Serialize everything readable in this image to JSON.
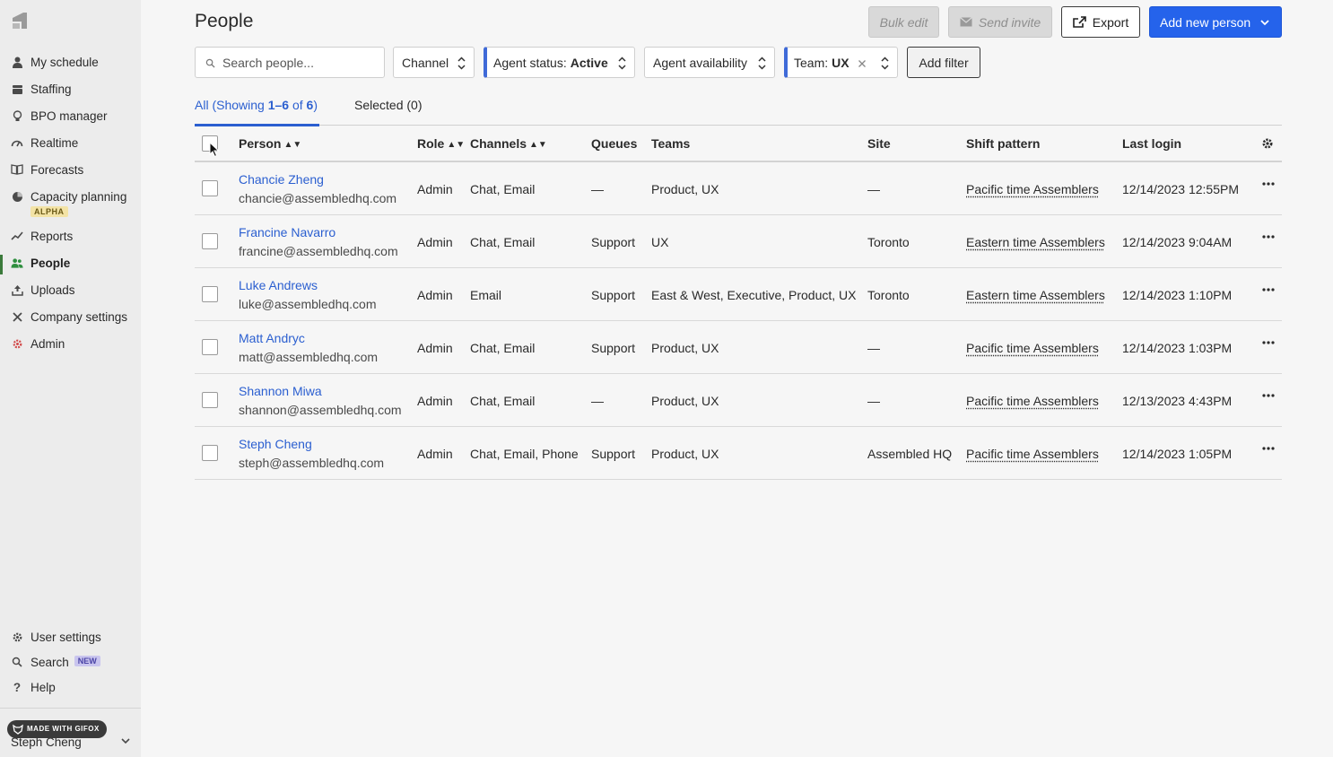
{
  "sidebar": {
    "items": [
      {
        "label": "My schedule",
        "icon": "person-icon"
      },
      {
        "label": "Staffing",
        "icon": "staffing-icon"
      },
      {
        "label": "BPO manager",
        "icon": "lightbulb-icon"
      },
      {
        "label": "Realtime",
        "icon": "gauge-icon"
      },
      {
        "label": "Forecasts",
        "icon": "book-icon"
      },
      {
        "label": "Capacity planning",
        "icon": "pie-icon",
        "badge": "ALPHA"
      },
      {
        "label": "Reports",
        "icon": "trend-icon"
      },
      {
        "label": "People",
        "icon": "people-icon",
        "active": true
      },
      {
        "label": "Uploads",
        "icon": "upload-icon"
      },
      {
        "label": "Company settings",
        "icon": "tools-icon"
      },
      {
        "label": "Admin",
        "icon": "admin-gear-icon"
      }
    ],
    "bottom": [
      {
        "label": "User settings",
        "icon": "gear-icon"
      },
      {
        "label": "Search",
        "icon": "search-icon",
        "badge": "NEW"
      },
      {
        "label": "Help",
        "icon": "help-icon"
      }
    ],
    "user_name": "Steph Cheng",
    "gifox_label": "MADE WITH GIFOX"
  },
  "header": {
    "title": "People",
    "bulk_edit": "Bulk edit",
    "send_invite": "Send invite",
    "export": "Export",
    "add_new_person": "Add new person"
  },
  "filters": {
    "search_placeholder": "Search people...",
    "channel": "Channel",
    "agent_status_label": "Agent status:",
    "agent_status_value": "Active",
    "agent_availability": "Agent availability",
    "team_label": "Team:",
    "team_value": "UX",
    "add_filter": "Add filter"
  },
  "tabs": {
    "all_prefix": "All (Showing ",
    "all_range": "1–6",
    "all_mid": " of ",
    "all_total": "6",
    "all_suffix": ")",
    "selected": "Selected (0)"
  },
  "table": {
    "columns": {
      "person": "Person",
      "role": "Role",
      "channels": "Channels",
      "queues": "Queues",
      "teams": "Teams",
      "site": "Site",
      "shift": "Shift pattern",
      "last_login": "Last login"
    },
    "rows": [
      {
        "name": "Chancie Zheng",
        "email": "chancie@assembledhq.com",
        "role": "Admin",
        "channels": "Chat, Email",
        "queues": "—",
        "teams": "Product, UX",
        "site": "—",
        "shift": "Pacific time Assemblers",
        "last_login": "12/14/2023 12:55PM"
      },
      {
        "name": "Francine Navarro",
        "email": "francine@assembledhq.com",
        "role": "Admin",
        "channels": "Chat, Email",
        "queues": "Support",
        "teams": "UX",
        "site": "Toronto",
        "shift": "Eastern time Assemblers",
        "last_login": "12/14/2023 9:04AM"
      },
      {
        "name": "Luke Andrews",
        "email": "luke@assembledhq.com",
        "role": "Admin",
        "channels": "Email",
        "queues": "Support",
        "teams": "East & West, Executive, Product, UX",
        "site": "Toronto",
        "shift": "Eastern time Assemblers",
        "last_login": "12/14/2023 1:10PM"
      },
      {
        "name": "Matt Andryc",
        "email": "matt@assembledhq.com",
        "role": "Admin",
        "channels": "Chat, Email",
        "queues": "Support",
        "teams": "Product, UX",
        "site": "—",
        "shift": "Pacific time Assemblers",
        "last_login": "12/14/2023 1:03PM"
      },
      {
        "name": "Shannon Miwa",
        "email": "shannon@assembledhq.com",
        "role": "Admin",
        "channels": "Chat, Email",
        "queues": "—",
        "teams": "Product, UX",
        "site": "—",
        "shift": "Pacific time Assemblers",
        "last_login": "12/13/2023 4:43PM"
      },
      {
        "name": "Steph Cheng",
        "email": "steph@assembledhq.com",
        "role": "Admin",
        "channels": "Chat, Email, Phone",
        "queues": "Support",
        "teams": "Product, UX",
        "site": "Assembled HQ",
        "shift": "Pacific time Assemblers",
        "last_login": "12/14/2023 1:05PM"
      }
    ]
  }
}
